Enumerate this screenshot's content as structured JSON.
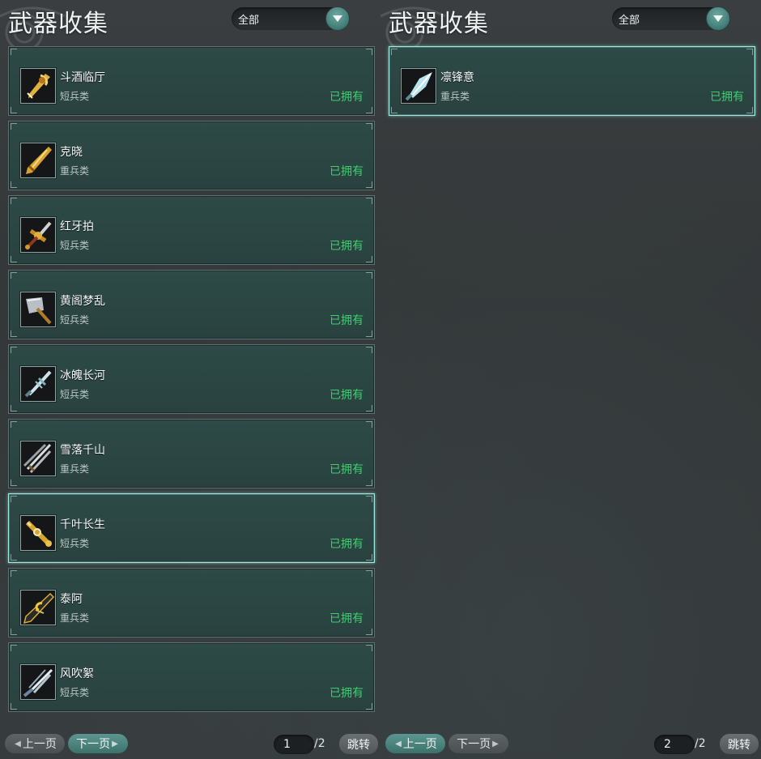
{
  "panels": [
    {
      "title": "武器收集",
      "filter": {
        "value": "全部"
      },
      "items": [
        {
          "name": "斗酒临厅",
          "type": "短兵类",
          "status": "已拥有",
          "icon": "golden-ornate-blade-icon",
          "selected": false
        },
        {
          "name": "克晓",
          "type": "重兵类",
          "status": "已拥有",
          "icon": "golden-broadsword-icon",
          "selected": false
        },
        {
          "name": "红牙拍",
          "type": "短兵类",
          "status": "已拥有",
          "icon": "red-gold-crossguard-icon",
          "selected": false
        },
        {
          "name": "黄阁梦乱",
          "type": "短兵类",
          "status": "已拥有",
          "icon": "axe-blade-icon",
          "selected": false
        },
        {
          "name": "冰魄长河",
          "type": "短兵类",
          "status": "已拥有",
          "icon": "ice-dagger-icon",
          "selected": false
        },
        {
          "name": "雪落千山",
          "type": "重兵类",
          "status": "已拥有",
          "icon": "silver-claws-icon",
          "selected": false
        },
        {
          "name": "千叶长生",
          "type": "短兵类",
          "status": "已拥有",
          "icon": "jade-gold-rod-icon",
          "selected": true
        },
        {
          "name": "泰阿",
          "type": "重兵类",
          "status": "已拥有",
          "icon": "black-gold-greatsword-icon",
          "selected": false
        },
        {
          "name": "风吹絮",
          "type": "短兵类",
          "status": "已拥有",
          "icon": "feather-blades-icon",
          "selected": false
        }
      ],
      "pager": {
        "prev": "上一页",
        "next": "下一页",
        "page": "1",
        "total": "/2",
        "jump": "跳转"
      }
    },
    {
      "title": "武器收集",
      "filter": {
        "value": "全部"
      },
      "items": [
        {
          "name": "凛锋意",
          "type": "重兵类",
          "status": "已拥有",
          "icon": "crystal-spear-icon",
          "selected": true
        }
      ],
      "pager": {
        "prev": "上一页",
        "next": "下一页",
        "page": "2",
        "total": "/2",
        "jump": "跳转"
      }
    }
  ],
  "colors": {
    "owned": "#3bd16a",
    "accent": "#4a8a83",
    "selected_border": "#9fe9e0"
  }
}
